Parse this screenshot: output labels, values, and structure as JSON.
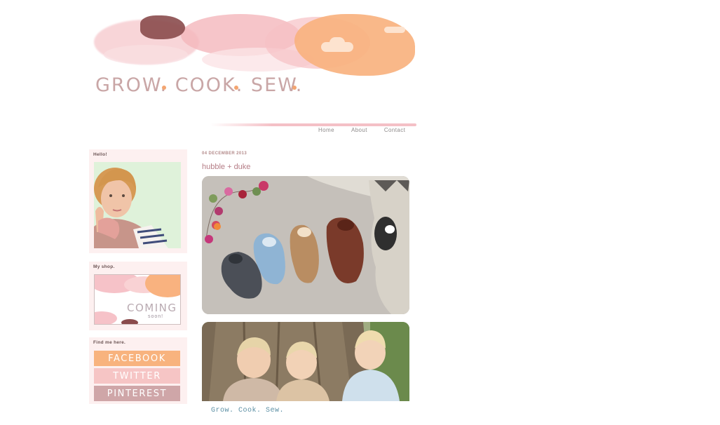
{
  "header": {
    "title": "GROW. COOK. SEW.",
    "nav": [
      "Home",
      "About",
      "Contact"
    ]
  },
  "sidebar": {
    "hello": {
      "heading": "Hello!"
    },
    "shop": {
      "heading": "My shop.",
      "image_text": "COMING",
      "image_subtext": "soon!"
    },
    "find": {
      "heading": "Find me here.",
      "links": [
        "FACEBOOK",
        "TWITTER",
        "PINTEREST"
      ]
    }
  },
  "post": {
    "date": "04 DECEMBER 2013",
    "title": "hubble + duke"
  },
  "footer": {
    "text": "Grow. Cook. Sew."
  },
  "colors": {
    "accent_orange": "#f9b27f",
    "accent_pink": "#f4c0c6",
    "accent_mauve": "#cfa6a8"
  }
}
